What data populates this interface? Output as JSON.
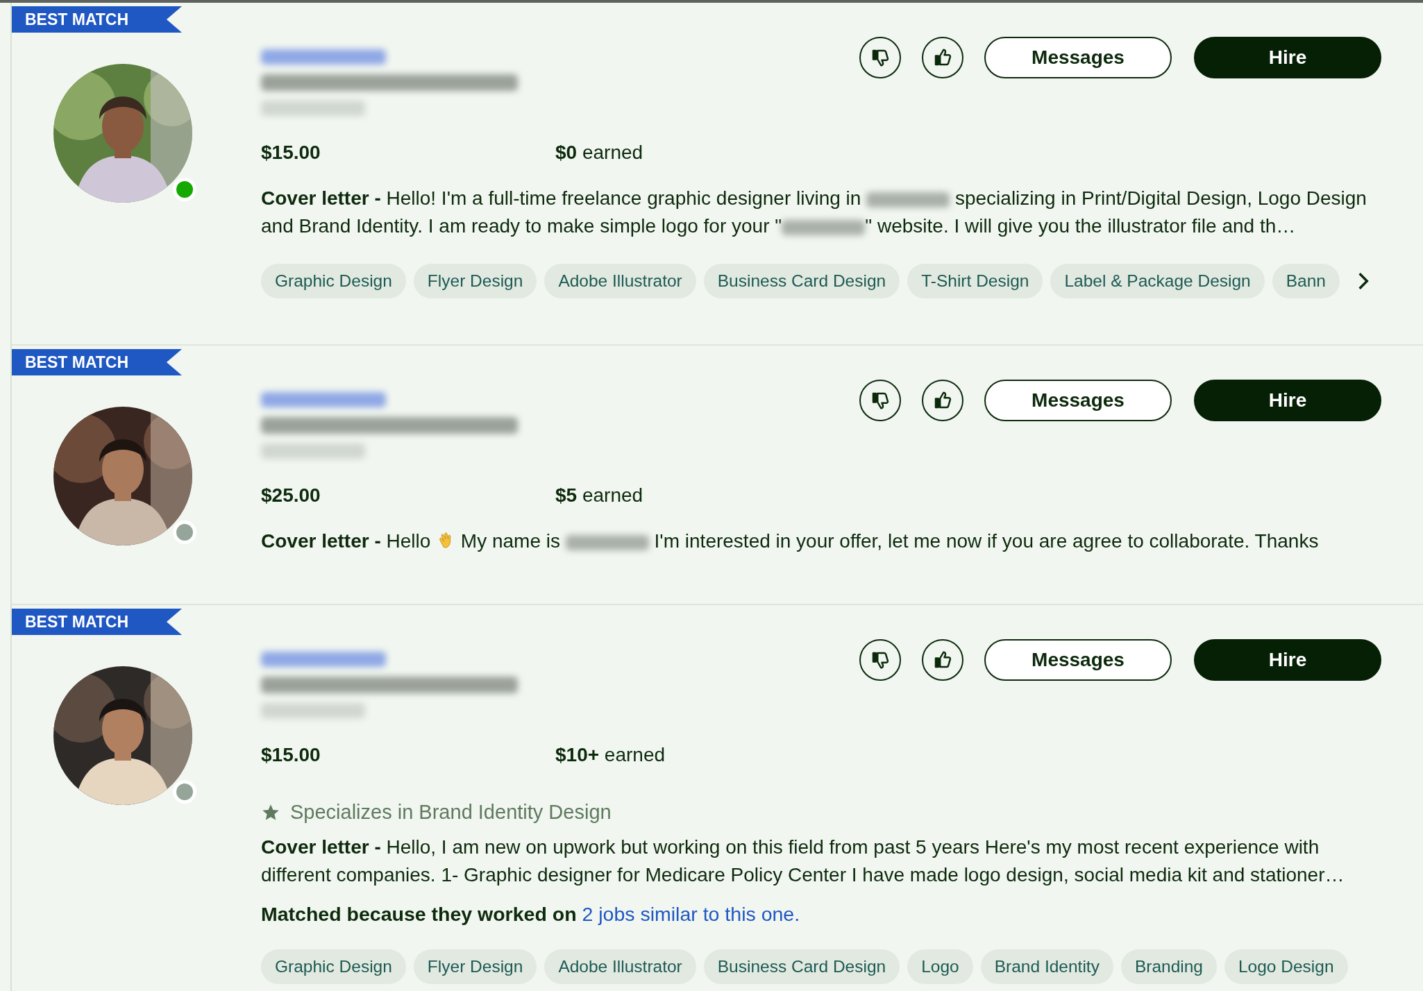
{
  "proposals": [
    {
      "badge": "BEST MATCH",
      "online": true,
      "photo": {
        "kind": "picture"
      },
      "actions": {
        "messages": "Messages",
        "hire": "Hire"
      },
      "rate": "$15.00",
      "earned": "**$0** earned",
      "cover_letter": {
        "label": "Cover letter -",
        "parts": [
          {
            "kind": "text",
            "text": "Hello! I'm a full-time freelance graphic designer living in "
          },
          {
            "kind": "redacted"
          },
          {
            "kind": "text",
            "text": " specializing in Print/Digital Design, Logo Design and Brand Identity. I am ready to make simple logo for your \""
          },
          {
            "kind": "redacted"
          },
          {
            "kind": "text",
            "text": "\" website. I will give you the illustrator file and th…"
          }
        ]
      },
      "skills": [
        "Graphic Design",
        "Flyer Design",
        "Adobe Illustrator",
        "Business Card Design",
        "T-Shirt Design",
        "Label & Package Design",
        "Bann"
      ],
      "more_skills": true
    },
    {
      "badge": "BEST MATCH",
      "online": false,
      "photo": {
        "kind": "picture"
      },
      "actions": {
        "messages": "Messages",
        "hire": "Hire"
      },
      "rate": "$25.00",
      "earned": "**$5** earned",
      "cover_letter": {
        "label": "Cover letter -",
        "parts": [
          {
            "kind": "text",
            "text": "Hello "
          },
          {
            "kind": "wave"
          },
          {
            "kind": "text",
            "text": " My name is "
          },
          {
            "kind": "redacted"
          },
          {
            "kind": "text",
            "text": " I'm interested in your offer, let me now if you are agree to collaborate. Thanks"
          }
        ]
      }
    },
    {
      "badge": "BEST MATCH",
      "online": false,
      "photo": {
        "kind": "picture"
      },
      "actions": {
        "messages": "Messages",
        "hire": "Hire"
      },
      "rate": "$15.00",
      "earned": "**$10+** earned",
      "specialty": "Specializes in Brand Identity Design",
      "cover_letter": {
        "label": "Cover letter -",
        "parts": [
          {
            "kind": "text",
            "text": "Hello, I am new on upwork but working on this field from past 5 years Here's my most recent experience with different companies. 1- Graphic designer for Medicare Policy Center I have made logo design, social media kit and stationer…"
          }
        ]
      },
      "matched": {
        "text": "Matched because they worked on",
        "link": "2 jobs similar to this one."
      },
      "skills": [
        "Graphic Design",
        "Flyer Design",
        "Adobe Illustrator",
        "Business Card Design",
        "Logo",
        "Brand Identity",
        "Branding",
        "Logo Design"
      ]
    }
  ]
}
